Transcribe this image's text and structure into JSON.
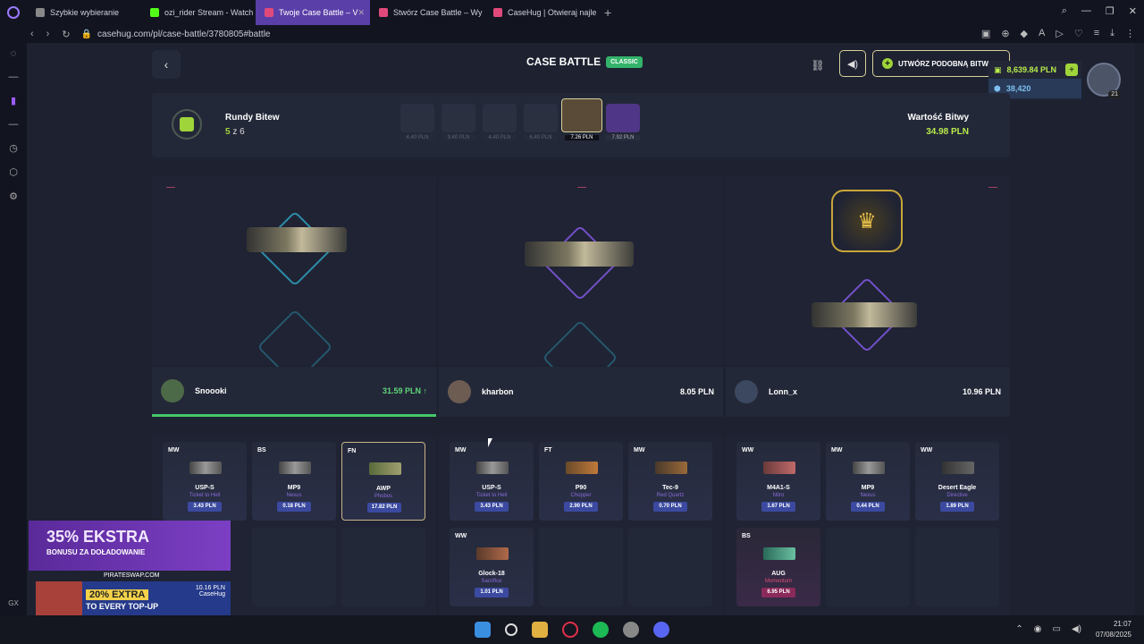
{
  "browser": {
    "tabs": [
      {
        "label": "Szybkie wybieranie",
        "color": "#888888"
      },
      {
        "label": "ozi_rider Stream - Watch",
        "color": "#53fc18"
      },
      {
        "label": "Twoje Case Battle – V",
        "color": "#e04a7a"
      },
      {
        "label": "Stwórz Case Battle – Wy",
        "color": "#e04a7a"
      },
      {
        "label": "CaseHug | Otwieraj najle",
        "color": "#e04a7a"
      }
    ],
    "url": "casehug.com/pl/case-battle/3780805#battle"
  },
  "header": {
    "title": "CASE BATTLE",
    "mode_badge": "CLASSIC",
    "create_label": "UTWÓRZ PODOBNĄ BITWĘ"
  },
  "wallet": {
    "balance": "8,639.84 PLN",
    "points": "38,420",
    "level": "21"
  },
  "rounds": {
    "label": "Rundy Bitew",
    "current": "5",
    "separator": " z ",
    "total": "6",
    "cases": [
      "4.40 PLN",
      "3.40 PLN",
      "4.40 PLN",
      "6.40 PLN",
      "7.26 PLN",
      "7.92 PLN"
    ],
    "value_label": "Wartość Bitwy",
    "value": "34.98 PLN"
  },
  "players": [
    {
      "name": "Snoooki",
      "value": "31.59 PLN ↑",
      "winner": true
    },
    {
      "name": "kharbon",
      "value": "8.05 PLN",
      "winner": false
    },
    {
      "name": "Lonn_x",
      "value": "10.96 PLN",
      "winner": false
    }
  ],
  "items": [
    [
      {
        "wear": "MW",
        "name": "USP-S",
        "skin": "Ticket to Hell",
        "price": "3.43 PLN"
      },
      {
        "wear": "BS",
        "name": "MP9",
        "skin": "Nexus",
        "price": "0.18 PLN"
      },
      {
        "wear": "FN",
        "name": "AWP",
        "skin": "Phobos",
        "price": "17.82 PLN"
      }
    ],
    [
      {
        "wear": "MW",
        "name": "USP-S",
        "skin": "Ticket to Hell",
        "price": "3.43 PLN"
      },
      {
        "wear": "FT",
        "name": "P90",
        "skin": "Chopper",
        "price": "2.90 PLN"
      },
      {
        "wear": "MW",
        "name": "Tec-9",
        "skin": "Red Quartz",
        "price": "0.70 PLN"
      },
      {
        "wear": "WW",
        "name": "Glock-18",
        "skin": "Sacrifice",
        "price": "1.01 PLN"
      }
    ],
    [
      {
        "wear": "WW",
        "name": "M4A1-S",
        "skin": "Nitro",
        "price": "1.67 PLN"
      },
      {
        "wear": "MW",
        "name": "MP9",
        "skin": "Nexus",
        "price": "0.44 PLN"
      },
      {
        "wear": "WW",
        "name": "Desert Eagle",
        "skin": "Directive",
        "price": "1.89 PLN"
      },
      {
        "wear": "BS",
        "name": "AUG",
        "skin": "Momentum",
        "price": "6.95 PLN"
      }
    ]
  ],
  "ad": {
    "headline": "35% EKSTRA",
    "subline": "BONUSU ZA DOŁADOWANIE",
    "site": "PIRATESWAP.COM",
    "badge": "20% EXTRA",
    "tagline": "TO EVERY TOP-UP",
    "price": "10.16 PLN",
    "brand": "CaseHug"
  },
  "taskbar": {
    "time": "21:07",
    "date": "07/08/2025"
  },
  "sidebar_gx": "GX"
}
